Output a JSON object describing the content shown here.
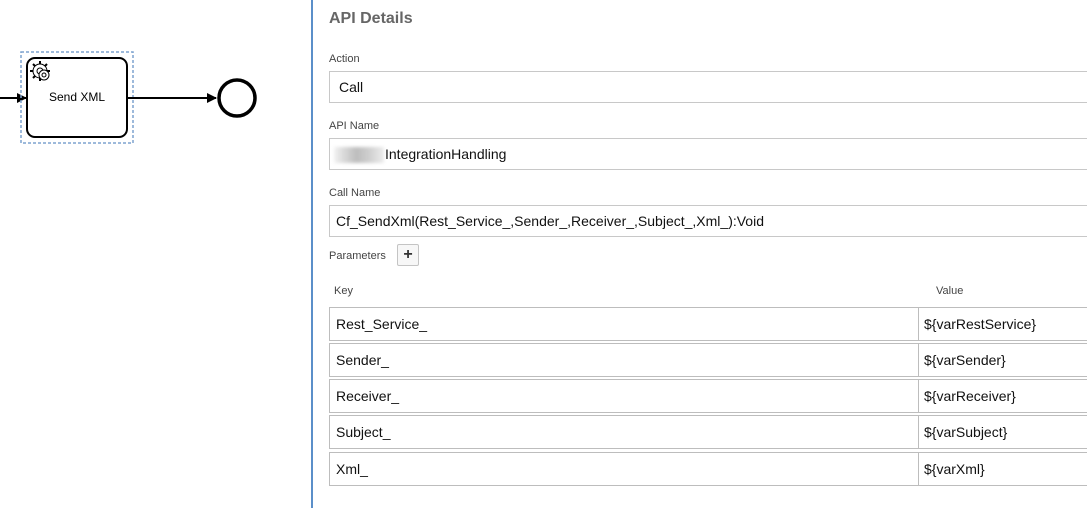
{
  "diagram": {
    "task_label": "Send XML"
  },
  "panel": {
    "title": "API Details",
    "action": {
      "label": "Action",
      "value": "Call"
    },
    "api_name": {
      "label": "API Name",
      "value": "IntegrationHandling"
    },
    "call_name": {
      "label": "Call Name",
      "value": "Cf_SendXml(Rest_Service_,Sender_,Receiver_,Subject_,Xml_):Void"
    },
    "parameters": {
      "label": "Parameters",
      "add_label": "+",
      "columns": {
        "key": "Key",
        "value": "Value"
      },
      "rows": [
        {
          "key": "Rest_Service_",
          "value": "${varRestService}"
        },
        {
          "key": "Sender_",
          "value": "${varSender}"
        },
        {
          "key": "Receiver_",
          "value": "${varReceiver}"
        },
        {
          "key": "Subject_",
          "value": "${varSubject}"
        },
        {
          "key": "Xml_",
          "value": "${varXml}"
        }
      ]
    }
  },
  "colors": {
    "accent_divider": "#5b8fc9",
    "selection_outline": "#7fa4cf"
  }
}
